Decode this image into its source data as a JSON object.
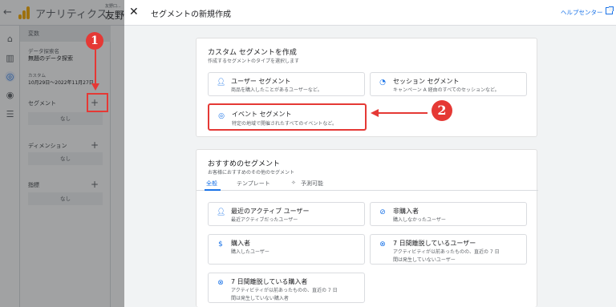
{
  "background": {
    "app_title": "アナリティクス",
    "account_label": "友野口...",
    "account_name": "友野",
    "variables": {
      "header": "変数",
      "exploration_name_label": "データ探索名",
      "exploration_name": "無題のデータ探索",
      "date_label": "カスタム",
      "date_range": "10月29日〜2022年11月27日",
      "segments_label": "セグメント",
      "dimensions_label": "ディメンション",
      "metrics_label": "指標",
      "none_label": "なし"
    },
    "badge_1": "1",
    "badge_2": "2"
  },
  "dialog": {
    "title": "セグメントの新規作成",
    "help_link": "ヘルプセンター",
    "custom": {
      "title": "カスタム セグメントを作成",
      "subtitle": "作成するセグメントのタイプを選択します",
      "options": [
        {
          "icon": "person-icon",
          "title": "ユーザー セグメント",
          "desc": "商品を購入したことがあるユーザーなど。"
        },
        {
          "icon": "session-icon",
          "title": "セッション セグメント",
          "desc": "キャンペーン A 経由のすべてのセッションなど。"
        },
        {
          "icon": "event-icon",
          "title": "イベント セグメント",
          "desc": "特定の地域で開催されたすべてのイベントなど。"
        }
      ]
    },
    "suggested": {
      "title": "おすすめのセグメント",
      "subtitle": "お客様におすすめのその他のセグメント",
      "tabs": [
        "全般",
        "テンプレート",
        "予測可能"
      ],
      "items": [
        {
          "icon": "person-icon",
          "title": "最近のアクティブ ユーザー",
          "desc": "最近アクティブだったユーザー",
          "desc2": ""
        },
        {
          "icon": "no-purchase-icon",
          "title": "非購入者",
          "desc": "購入しなかったユーザー",
          "desc2": ""
        },
        {
          "icon": "dollar-icon",
          "title": "購入者",
          "desc": "購入したユーザー",
          "desc2": ""
        },
        {
          "icon": "churn-icon",
          "title": "7 日間離脱しているユーザー",
          "desc": "アクティビティが以前あったものの、直近の 7 日",
          "desc2": "間は発生していないユーザー"
        },
        {
          "icon": "churn-icon",
          "title": "7 日間離脱している購入者",
          "desc": "アクティビティが以前あったものの、直近の 7 日",
          "desc2": "間は発生していない購入者"
        }
      ]
    }
  }
}
